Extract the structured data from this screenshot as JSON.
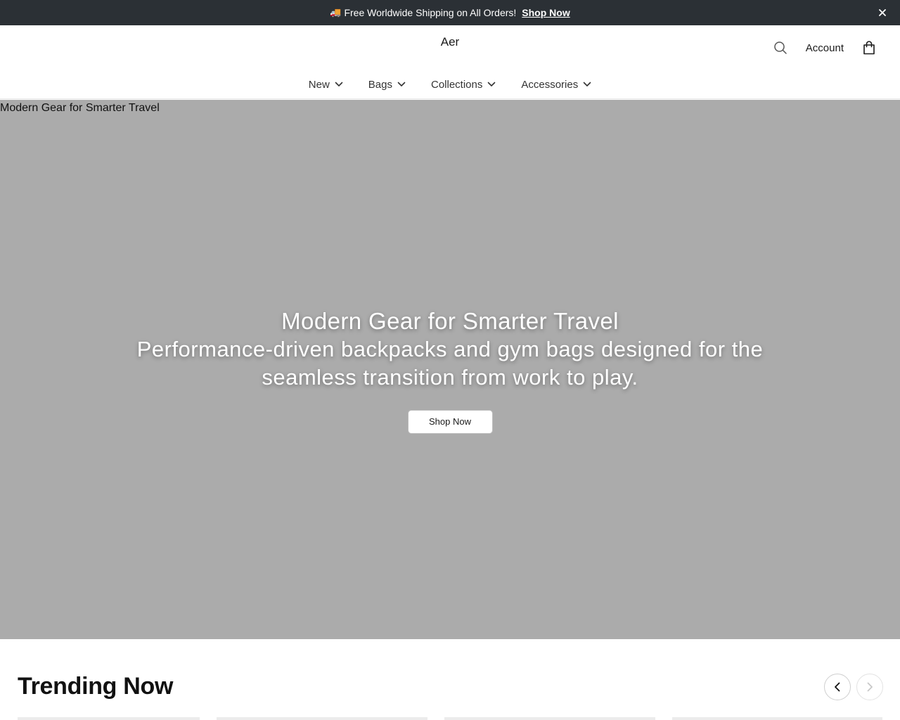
{
  "announcement": {
    "icon": "truck-icon",
    "truck_glyph": "🚚",
    "message": "Free Worldwide Shipping on All Orders!",
    "link_label": "Shop Now",
    "close_glyph": "✕"
  },
  "header": {
    "logo": "Aer",
    "account_label": "Account",
    "icons": [
      "search-icon",
      "cart-icon"
    ]
  },
  "nav": {
    "items": [
      {
        "label": "New"
      },
      {
        "label": "Bags"
      },
      {
        "label": "Collections"
      },
      {
        "label": "Accessories"
      }
    ]
  },
  "hero": {
    "alt_text": "Modern Gear for Smarter Travel",
    "title": "Modern Gear for Smarter Travel",
    "subtitle": "Performance-driven backpacks and gym bags designed for the seamless transition from work to play.",
    "cta_label": "Shop Now",
    "background_color": "#ababab"
  },
  "trending": {
    "title": "Trending Now"
  },
  "colors": {
    "announcement_bg": "#2b3035",
    "text": "#1a1a1a"
  }
}
